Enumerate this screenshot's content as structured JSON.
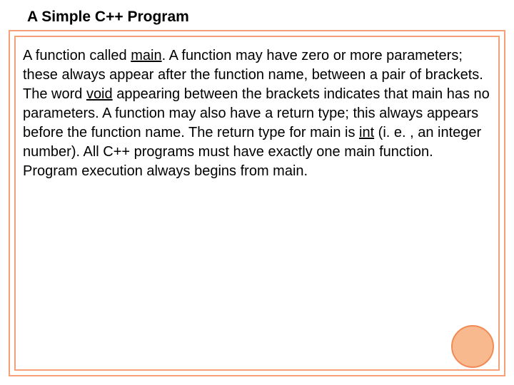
{
  "title": "A Simple C++ Program",
  "body": {
    "p1a": "A function called ",
    "p1_main": "main",
    "p1b": ". A function may have zero or more parameters; these always appear after the function name, between a pair of brackets. The word ",
    "p1_void": "void",
    "p1c": " appearing between the brackets indicates that main has no parameters. A function may also have a return type; this always appears before the function name. The return type for main is ",
    "p1_int": "int",
    "p1d": " (i. e. , an integer number). All C++ programs must have exactly one main function. Program execution always begins from main."
  }
}
